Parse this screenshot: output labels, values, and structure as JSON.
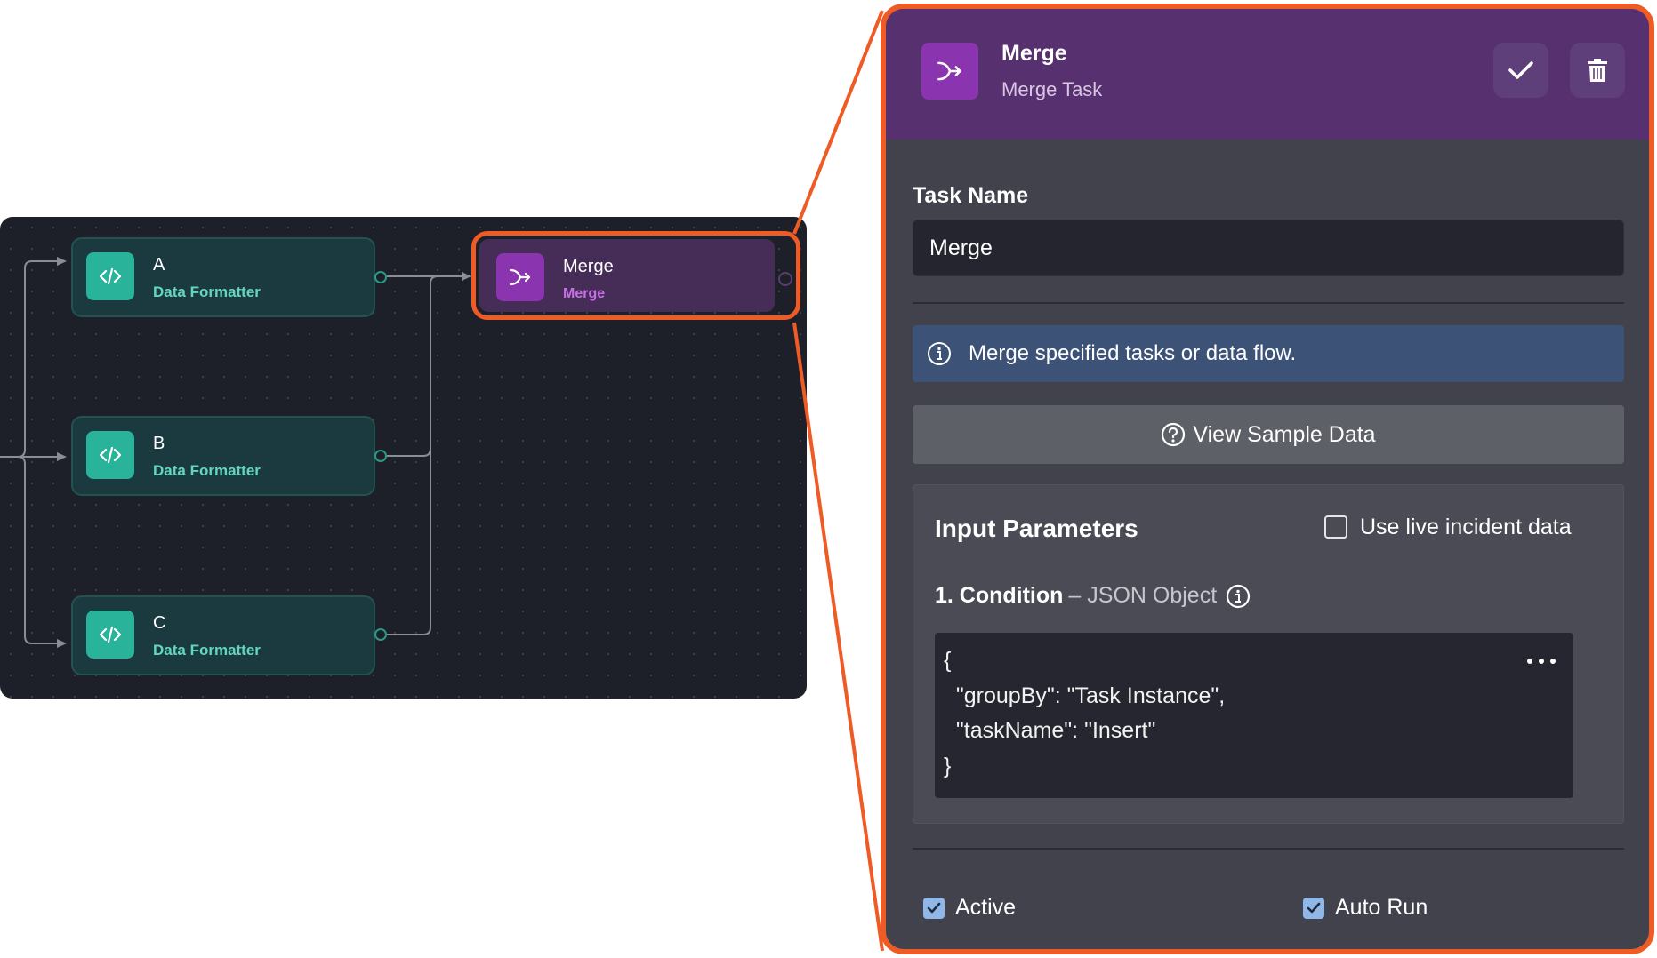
{
  "canvas": {
    "nodes": [
      {
        "title": "A",
        "subtitle": "Data Formatter",
        "icon": "code-icon"
      },
      {
        "title": "B",
        "subtitle": "Data Formatter",
        "icon": "code-icon"
      },
      {
        "title": "C",
        "subtitle": "Data Formatter",
        "icon": "code-icon"
      }
    ],
    "merge_node": {
      "title": "Merge",
      "subtitle": "Merge",
      "icon": "merge-icon",
      "selected": true
    }
  },
  "panel": {
    "header": {
      "title": "Merge",
      "subtitle": "Merge Task",
      "icon": "merge-icon",
      "confirm_icon": "check-icon",
      "delete_icon": "trash-icon"
    },
    "task_name_label": "Task Name",
    "task_name_value": "Merge",
    "info_text": "Merge specified tasks or data flow.",
    "sample_button_label": "View Sample Data",
    "input_parameters": {
      "title": "Input Parameters",
      "live_data_label": "Use live incident data",
      "live_data_checked": false,
      "condition_label": "1. Condition",
      "condition_type": "– JSON Object",
      "condition_code": "{\n  \"groupBy\": \"Task Instance\",\n  \"taskName\": \"Insert\"\n}"
    },
    "active_label": "Active",
    "active_checked": true,
    "autorun_label": "Auto Run",
    "autorun_checked": true
  },
  "colors": {
    "highlight": "#ef5b25",
    "merge_accent": "#8a34b0",
    "formatter_accent": "#29b39b",
    "header_bg": "#57316f",
    "info_bg": "#3c5277"
  }
}
